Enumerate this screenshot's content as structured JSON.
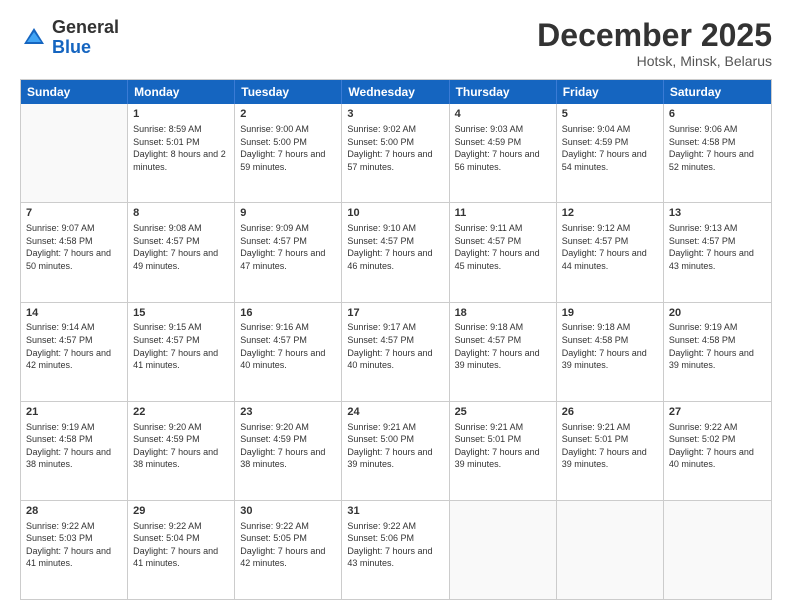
{
  "header": {
    "logo": {
      "general": "General",
      "blue": "Blue"
    },
    "title": "December 2025",
    "location": "Hotsk, Minsk, Belarus"
  },
  "calendar": {
    "days": [
      "Sunday",
      "Monday",
      "Tuesday",
      "Wednesday",
      "Thursday",
      "Friday",
      "Saturday"
    ],
    "weeks": [
      [
        {
          "day": "",
          "info": ""
        },
        {
          "day": "1",
          "sunrise": "Sunrise: 8:59 AM",
          "sunset": "Sunset: 5:01 PM",
          "daylight": "Daylight: 8 hours and 2 minutes."
        },
        {
          "day": "2",
          "sunrise": "Sunrise: 9:00 AM",
          "sunset": "Sunset: 5:00 PM",
          "daylight": "Daylight: 7 hours and 59 minutes."
        },
        {
          "day": "3",
          "sunrise": "Sunrise: 9:02 AM",
          "sunset": "Sunset: 5:00 PM",
          "daylight": "Daylight: 7 hours and 57 minutes."
        },
        {
          "day": "4",
          "sunrise": "Sunrise: 9:03 AM",
          "sunset": "Sunset: 4:59 PM",
          "daylight": "Daylight: 7 hours and 56 minutes."
        },
        {
          "day": "5",
          "sunrise": "Sunrise: 9:04 AM",
          "sunset": "Sunset: 4:59 PM",
          "daylight": "Daylight: 7 hours and 54 minutes."
        },
        {
          "day": "6",
          "sunrise": "Sunrise: 9:06 AM",
          "sunset": "Sunset: 4:58 PM",
          "daylight": "Daylight: 7 hours and 52 minutes."
        }
      ],
      [
        {
          "day": "7",
          "sunrise": "Sunrise: 9:07 AM",
          "sunset": "Sunset: 4:58 PM",
          "daylight": "Daylight: 7 hours and 50 minutes."
        },
        {
          "day": "8",
          "sunrise": "Sunrise: 9:08 AM",
          "sunset": "Sunset: 4:57 PM",
          "daylight": "Daylight: 7 hours and 49 minutes."
        },
        {
          "day": "9",
          "sunrise": "Sunrise: 9:09 AM",
          "sunset": "Sunset: 4:57 PM",
          "daylight": "Daylight: 7 hours and 47 minutes."
        },
        {
          "day": "10",
          "sunrise": "Sunrise: 9:10 AM",
          "sunset": "Sunset: 4:57 PM",
          "daylight": "Daylight: 7 hours and 46 minutes."
        },
        {
          "day": "11",
          "sunrise": "Sunrise: 9:11 AM",
          "sunset": "Sunset: 4:57 PM",
          "daylight": "Daylight: 7 hours and 45 minutes."
        },
        {
          "day": "12",
          "sunrise": "Sunrise: 9:12 AM",
          "sunset": "Sunset: 4:57 PM",
          "daylight": "Daylight: 7 hours and 44 minutes."
        },
        {
          "day": "13",
          "sunrise": "Sunrise: 9:13 AM",
          "sunset": "Sunset: 4:57 PM",
          "daylight": "Daylight: 7 hours and 43 minutes."
        }
      ],
      [
        {
          "day": "14",
          "sunrise": "Sunrise: 9:14 AM",
          "sunset": "Sunset: 4:57 PM",
          "daylight": "Daylight: 7 hours and 42 minutes."
        },
        {
          "day": "15",
          "sunrise": "Sunrise: 9:15 AM",
          "sunset": "Sunset: 4:57 PM",
          "daylight": "Daylight: 7 hours and 41 minutes."
        },
        {
          "day": "16",
          "sunrise": "Sunrise: 9:16 AM",
          "sunset": "Sunset: 4:57 PM",
          "daylight": "Daylight: 7 hours and 40 minutes."
        },
        {
          "day": "17",
          "sunrise": "Sunrise: 9:17 AM",
          "sunset": "Sunset: 4:57 PM",
          "daylight": "Daylight: 7 hours and 40 minutes."
        },
        {
          "day": "18",
          "sunrise": "Sunrise: 9:18 AM",
          "sunset": "Sunset: 4:57 PM",
          "daylight": "Daylight: 7 hours and 39 minutes."
        },
        {
          "day": "19",
          "sunrise": "Sunrise: 9:18 AM",
          "sunset": "Sunset: 4:58 PM",
          "daylight": "Daylight: 7 hours and 39 minutes."
        },
        {
          "day": "20",
          "sunrise": "Sunrise: 9:19 AM",
          "sunset": "Sunset: 4:58 PM",
          "daylight": "Daylight: 7 hours and 39 minutes."
        }
      ],
      [
        {
          "day": "21",
          "sunrise": "Sunrise: 9:19 AM",
          "sunset": "Sunset: 4:58 PM",
          "daylight": "Daylight: 7 hours and 38 minutes."
        },
        {
          "day": "22",
          "sunrise": "Sunrise: 9:20 AM",
          "sunset": "Sunset: 4:59 PM",
          "daylight": "Daylight: 7 hours and 38 minutes."
        },
        {
          "day": "23",
          "sunrise": "Sunrise: 9:20 AM",
          "sunset": "Sunset: 4:59 PM",
          "daylight": "Daylight: 7 hours and 38 minutes."
        },
        {
          "day": "24",
          "sunrise": "Sunrise: 9:21 AM",
          "sunset": "Sunset: 5:00 PM",
          "daylight": "Daylight: 7 hours and 39 minutes."
        },
        {
          "day": "25",
          "sunrise": "Sunrise: 9:21 AM",
          "sunset": "Sunset: 5:01 PM",
          "daylight": "Daylight: 7 hours and 39 minutes."
        },
        {
          "day": "26",
          "sunrise": "Sunrise: 9:21 AM",
          "sunset": "Sunset: 5:01 PM",
          "daylight": "Daylight: 7 hours and 39 minutes."
        },
        {
          "day": "27",
          "sunrise": "Sunrise: 9:22 AM",
          "sunset": "Sunset: 5:02 PM",
          "daylight": "Daylight: 7 hours and 40 minutes."
        }
      ],
      [
        {
          "day": "28",
          "sunrise": "Sunrise: 9:22 AM",
          "sunset": "Sunset: 5:03 PM",
          "daylight": "Daylight: 7 hours and 41 minutes."
        },
        {
          "day": "29",
          "sunrise": "Sunrise: 9:22 AM",
          "sunset": "Sunset: 5:04 PM",
          "daylight": "Daylight: 7 hours and 41 minutes."
        },
        {
          "day": "30",
          "sunrise": "Sunrise: 9:22 AM",
          "sunset": "Sunset: 5:05 PM",
          "daylight": "Daylight: 7 hours and 42 minutes."
        },
        {
          "day": "31",
          "sunrise": "Sunrise: 9:22 AM",
          "sunset": "Sunset: 5:06 PM",
          "daylight": "Daylight: 7 hours and 43 minutes."
        },
        {
          "day": "",
          "info": ""
        },
        {
          "day": "",
          "info": ""
        },
        {
          "day": "",
          "info": ""
        }
      ]
    ]
  }
}
